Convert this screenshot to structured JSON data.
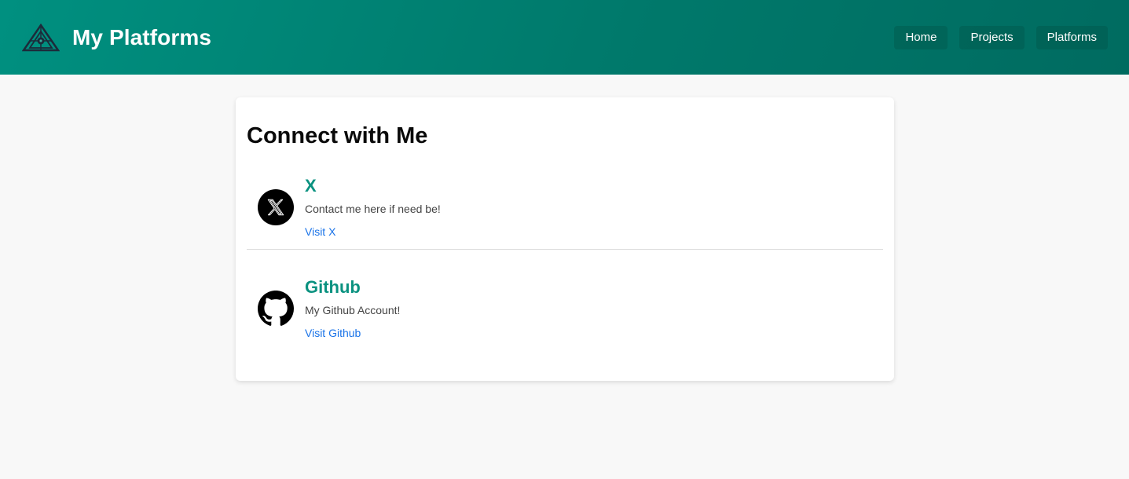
{
  "header": {
    "title": "My Platforms",
    "logo_icon": "triangle-eye-logo-icon",
    "nav": [
      {
        "label": "Home"
      },
      {
        "label": "Projects"
      },
      {
        "label": "Platforms"
      }
    ]
  },
  "main": {
    "title": "Connect with Me",
    "platforms": [
      {
        "icon": "x-logo-icon",
        "name": "X",
        "description": "Contact me here if need be!",
        "link_label": "Visit X"
      },
      {
        "icon": "github-logo-icon",
        "name": "Github",
        "description": "My Github Account!",
        "link_label": "Visit Github"
      }
    ]
  },
  "colors": {
    "header_start": "#009080",
    "header_end": "#006b60",
    "accent": "#0b9280",
    "link": "#1a73e8",
    "background": "#f8f8f8"
  }
}
